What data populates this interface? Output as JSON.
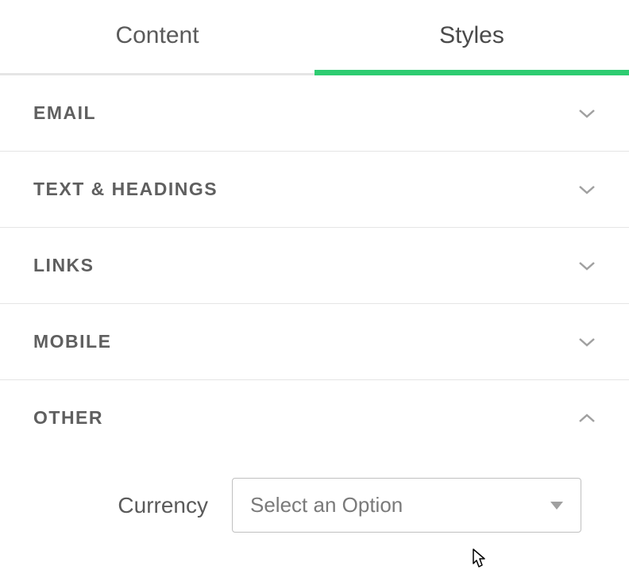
{
  "tabs": {
    "content": {
      "label": "Content",
      "active": false
    },
    "styles": {
      "label": "Styles",
      "active": true
    }
  },
  "sections": [
    {
      "id": "email",
      "title": "EMAIL",
      "expanded": false
    },
    {
      "id": "text-headings",
      "title": "TEXT & HEADINGS",
      "expanded": false
    },
    {
      "id": "links",
      "title": "LINKS",
      "expanded": false
    },
    {
      "id": "mobile",
      "title": "MOBILE",
      "expanded": false
    },
    {
      "id": "other",
      "title": "OTHER",
      "expanded": true
    }
  ],
  "other": {
    "currency": {
      "label": "Currency",
      "placeholder": "Select an Option",
      "value": ""
    }
  },
  "colors": {
    "accent": "#2ecc71",
    "border": "#e5e5e5",
    "text": "#5a5a5a"
  }
}
